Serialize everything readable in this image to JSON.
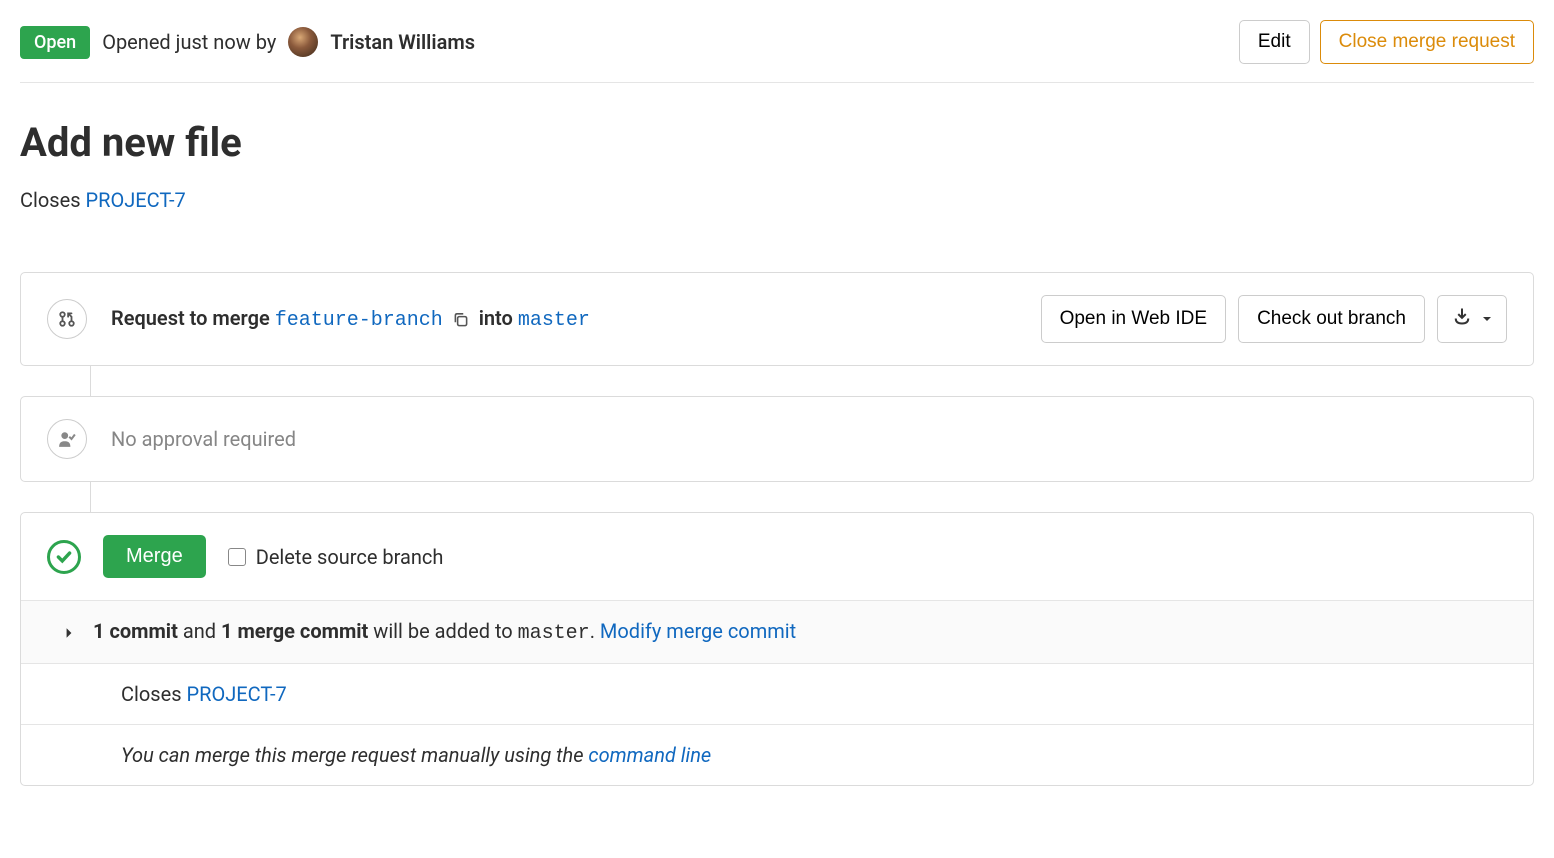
{
  "header": {
    "status": "Open",
    "opened_prefix": "Opened just now by",
    "author": "Tristan Williams",
    "edit_label": "Edit",
    "close_label": "Close merge request"
  },
  "title": "Add new file",
  "description": {
    "prefix": "Closes ",
    "issue_ref": "PROJECT-7"
  },
  "merge_widget": {
    "request_prefix": "Request to merge ",
    "source_branch": "feature-branch",
    "into_text": " into ",
    "target_branch": "master",
    "web_ide_label": "Open in Web IDE",
    "checkout_label": "Check out branch"
  },
  "approval": {
    "text": "No approval required"
  },
  "merge_action": {
    "button_label": "Merge",
    "delete_branch_label": "Delete source branch"
  },
  "commit_summary": {
    "commit_count": "1 commit",
    "and_text": " and ",
    "merge_commit_count": "1 merge commit",
    "middle_text": " will be added to ",
    "target_branch": "master",
    "suffix": ". ",
    "modify_link": "Modify merge commit"
  },
  "closes_row": {
    "prefix": "Closes ",
    "issue_ref": "PROJECT-7"
  },
  "manual_merge": {
    "prefix": "You can merge this merge request manually using the ",
    "link": "command line"
  }
}
